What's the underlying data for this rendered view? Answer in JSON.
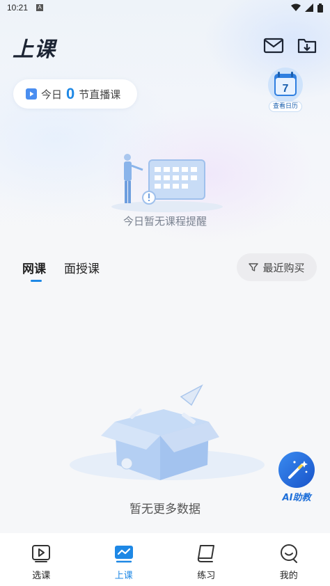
{
  "status_bar": {
    "time": "10:21",
    "notification_letter": "A"
  },
  "header": {
    "title": "上课"
  },
  "today": {
    "prefix": "今日",
    "count": "0",
    "suffix": "节直播课"
  },
  "calendar": {
    "day": "7",
    "label": "查看日历"
  },
  "schedule_empty": {
    "message": "今日暂无课程提醒"
  },
  "course_tabs": [
    {
      "label": "网课",
      "active": true
    },
    {
      "label": "面授课",
      "active": false
    }
  ],
  "filter": {
    "label": "最近购买"
  },
  "list_empty": {
    "message": "暂无更多数据"
  },
  "ai_assistant": {
    "label": "AI助教"
  },
  "bottom_nav": [
    {
      "label": "选课",
      "icon": "play-course-icon",
      "active": false
    },
    {
      "label": "上课",
      "icon": "classroom-icon",
      "active": true
    },
    {
      "label": "练习",
      "icon": "practice-book-icon",
      "active": false
    },
    {
      "label": "我的",
      "icon": "profile-icon",
      "active": false
    }
  ],
  "colors": {
    "accent": "#1e88e5",
    "title": "#1c2433",
    "muted": "#7a8290"
  }
}
